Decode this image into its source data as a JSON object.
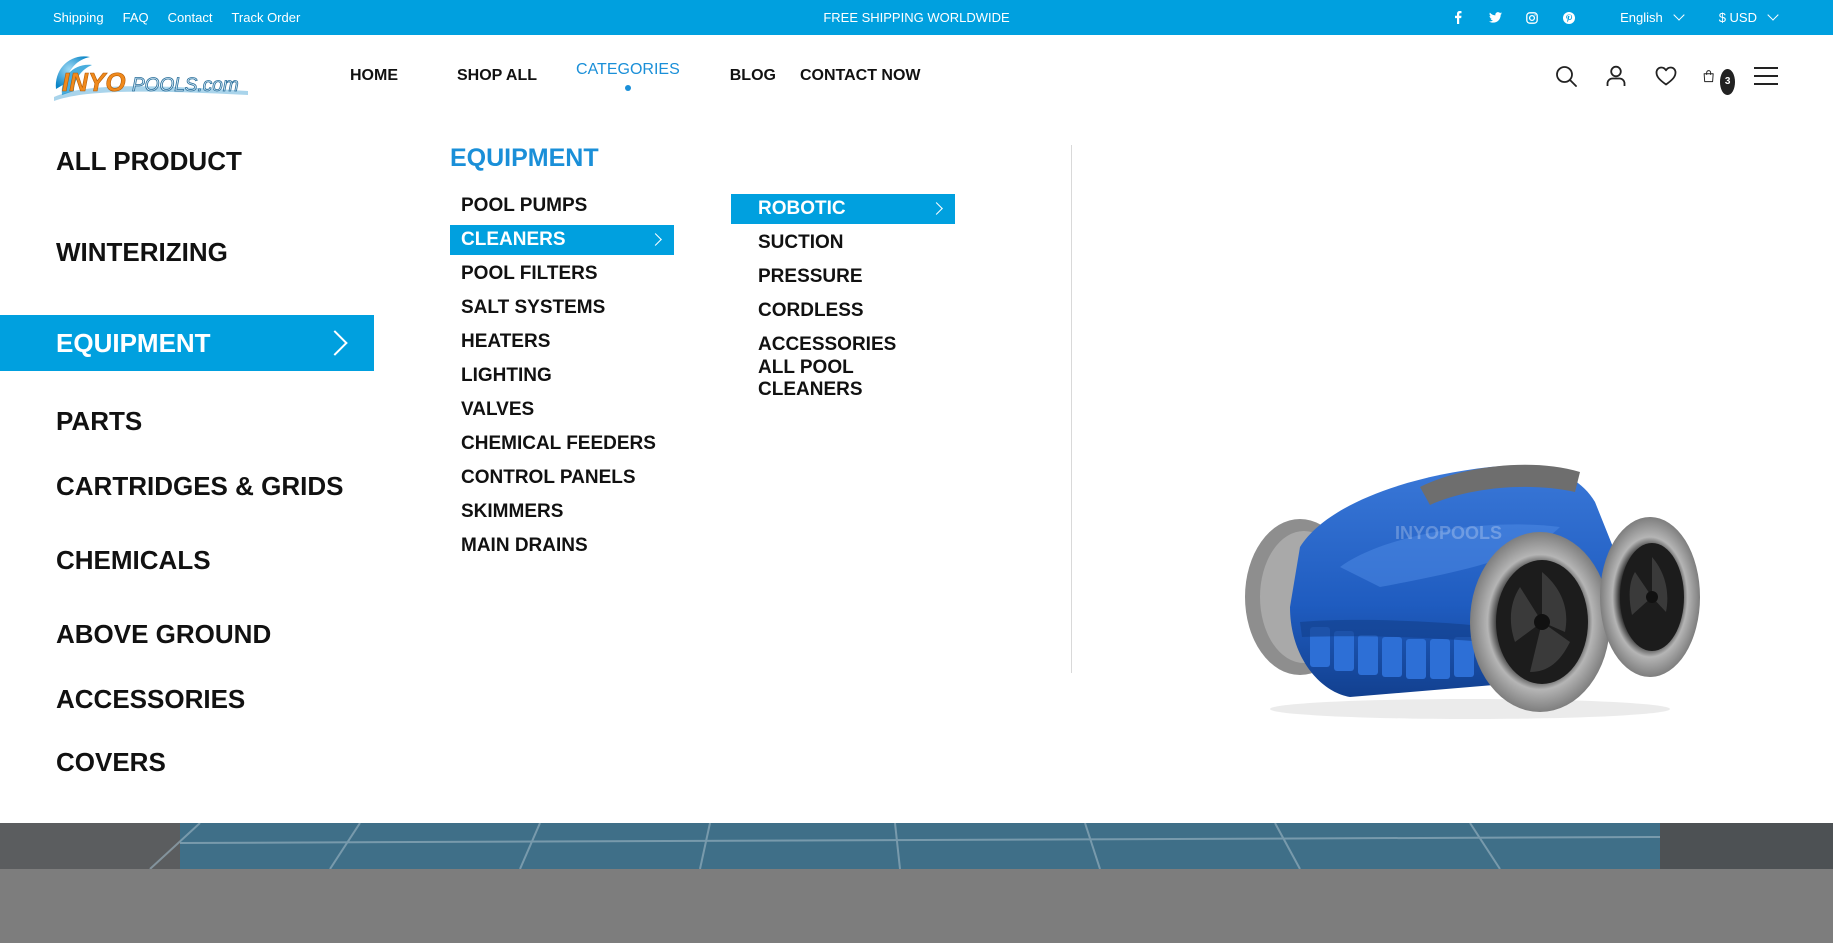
{
  "topbar": {
    "links": [
      "Shipping",
      "FAQ",
      "Contact",
      "Track Order"
    ],
    "promo": "FREE SHIPPING WORLDWIDE",
    "social_icons": [
      "facebook-icon",
      "twitter-icon",
      "instagram-icon",
      "pinterest-icon"
    ],
    "language": "English",
    "currency": "$ USD"
  },
  "header": {
    "logo_text": "INYOPOOLS.com",
    "nav": {
      "home": "HOME",
      "shop_all": "SHOP ALL",
      "categories": "CATEGORIES",
      "blog": "BLOG",
      "contact": "CONTACT NOW"
    },
    "icons": [
      "search-icon",
      "account-icon",
      "wishlist-icon",
      "cart-icon",
      "menu-icon"
    ],
    "cart_count": "3"
  },
  "mega_menu": {
    "categories": [
      "ALL PRODUCT",
      "WINTERIZING",
      "EQUIPMENT",
      "PARTS",
      "CARTRIDGES & GRIDS",
      "CHEMICALS",
      "ABOVE GROUND",
      "ACCESSORIES",
      "COVERS"
    ],
    "active_category": "EQUIPMENT",
    "equipment_title": "EQUIPMENT",
    "equipment_items": [
      "POOL PUMPS",
      "CLEANERS",
      "POOL FILTERS",
      "SALT SYSTEMS",
      "HEATERS",
      "LIGHTING",
      "VALVES",
      "CHEMICAL FEEDERS",
      "CONTROL PANELS",
      "SKIMMERS",
      "MAIN DRAINS"
    ],
    "active_equipment": "CLEANERS",
    "cleaner_items": [
      "ROBOTIC",
      "SUCTION",
      "PRESSURE",
      "CORDLESS",
      "ACCESSORIES",
      "ALL POOL CLEANERS"
    ],
    "active_cleaner": "ROBOTIC",
    "product_watermark": "INYOPOOLS"
  },
  "colors": {
    "brand_blue": "#00a0df",
    "link_blue": "#1a8fd8",
    "text": "#111111"
  }
}
